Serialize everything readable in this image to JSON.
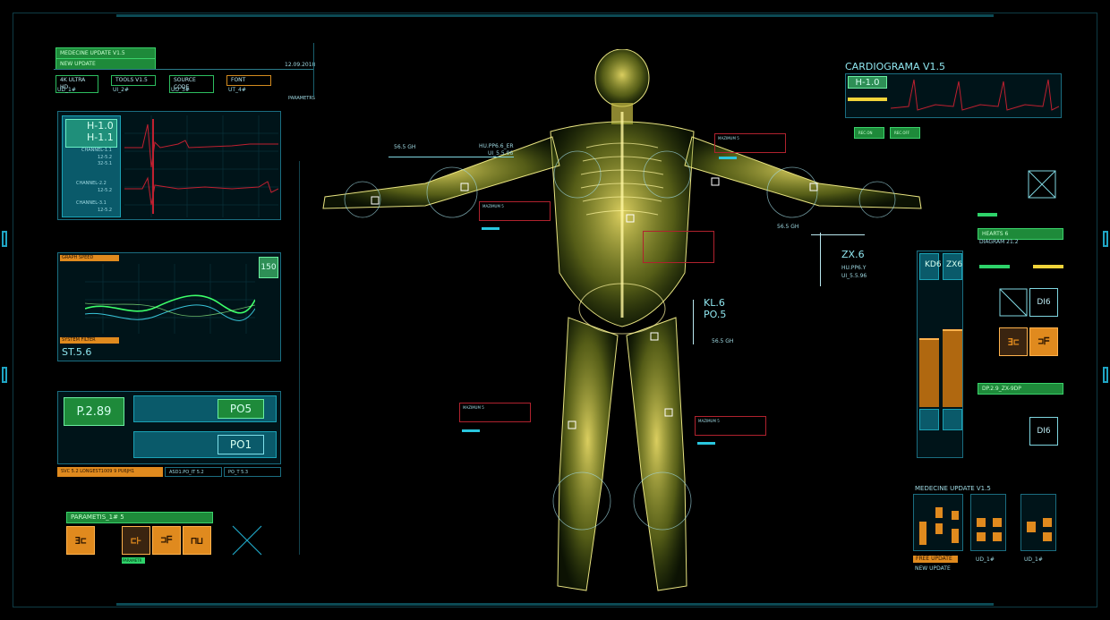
{
  "colors": {
    "accent": "#29c6de",
    "green": "#2ed36a",
    "orange": "#e08a1e",
    "red": "#b0222e",
    "body_glow": "#d9d24a"
  },
  "top_left": {
    "title": "MEDECINE UPDATE V1.5",
    "subtitle": "NEW UPDATE",
    "date": "12.09.2018",
    "tags": [
      {
        "label": "4K ULTRA HD",
        "value": "UD_1#"
      },
      {
        "label": "TOOLS V1.5",
        "value": "UI_2#"
      },
      {
        "label": "SOURCE CODE",
        "value": "UO_3#"
      },
      {
        "label": "FONT",
        "value": "UT_4#"
      }
    ],
    "params_label": "PARAMETRS"
  },
  "ecg_panel": {
    "h1": "H-1.0",
    "h2": "H-1.1",
    "ch1": "CHANNEL-1.1",
    "ch1_vals": [
      "12-5.2",
      "32-5.1"
    ],
    "ch2": "CHANNEL-2.2",
    "ch2_val": "12-5.2",
    "ch3": "CHANNEL-3.1",
    "ch3_val": "12-5.2"
  },
  "wave_panel": {
    "top_tag": "GRAPH SPEED",
    "badge": "150",
    "bottom_tag": "SYSTEM FILTER",
    "label": "ST.5.6"
  },
  "po_panel": {
    "value": "P.2.89",
    "po5": "PO5",
    "po1": "PO1",
    "tabs": [
      "SVC 5.2 LONGEST1009 9 PU6JH1",
      "ASD1.PO_IT 5.2",
      "PO_T 5.3"
    ]
  },
  "param_panel": {
    "title": "PARAMETIS_1#  5",
    "icons": [
      "Ǝ⊏",
      "⊏⊦",
      "⊐ᖴ",
      "⊓⊔"
    ],
    "tag": "PARAMETR"
  },
  "body_labels": {
    "l1": "56.5 GH",
    "l2": "HU.PP6.6_ER",
    "l3": "UI_5.5.96",
    "kl": "KL.6",
    "po": "PO.5",
    "kl_sub": "56.5 GH",
    "zx": "ZX.6",
    "zx_sub1": "HU.PP6.Y",
    "zx_sub2": "UI_5.5.96",
    "r_label": "56.5 GH",
    "red_boxes": [
      "MAZIMUM 5",
      "MAZIMUM 5",
      "MAZIMUM 5",
      "MAZIMUM 5"
    ]
  },
  "cardio": {
    "title": "CARDIOGRAMA V1.5",
    "h": "H-1.0",
    "tags": [
      "REC.ON",
      "REC.OFF"
    ]
  },
  "right_side": {
    "hearts": "HEARTS 6",
    "diagram": "DIAGRAM 21.2",
    "kd": "KD6",
    "zx": "ZX6",
    "di1": "DI6",
    "di2": "DI6",
    "dp": "DP.2.9_ZX-9DP",
    "meter_left": 0.55,
    "meter_right": 0.62
  },
  "bottom_right": {
    "title": "MEDECINE UPDATE V1.5",
    "free": "FREE UPDATE",
    "new": "NEW UPDATE",
    "ud": "UD_1#",
    "ud2": "UD_1#"
  }
}
